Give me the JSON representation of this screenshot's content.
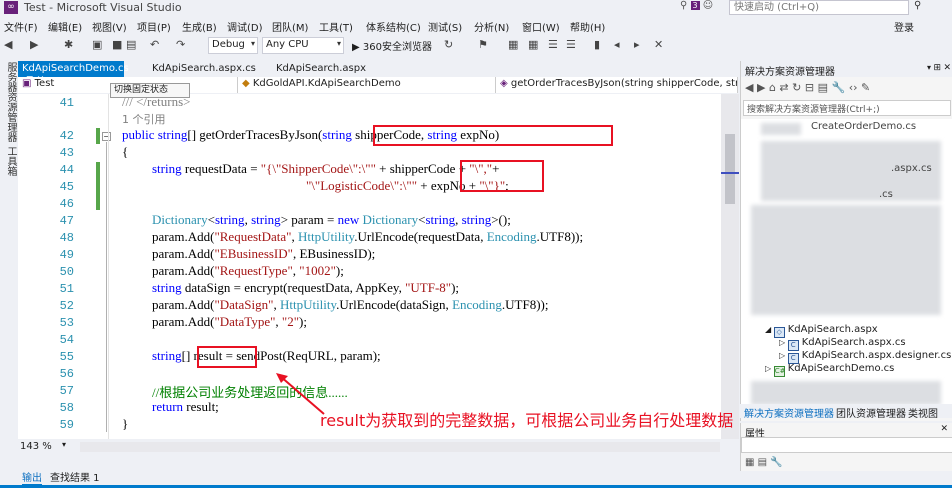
{
  "window": {
    "title": "Test - Microsoft Visual Studio",
    "notification_count": "3",
    "quick_launch_placeholder": "快速启动 (Ctrl+Q)",
    "login": "登录"
  },
  "menu": [
    "文件(F)",
    "编辑(E)",
    "视图(V)",
    "项目(P)",
    "生成(B)",
    "调试(D)",
    "团队(M)",
    "工具(T)",
    "体系结构(C)",
    "测试(S)",
    "分析(N)",
    "窗口(W)",
    "帮助(H)"
  ],
  "toolbar": {
    "config": "Debug",
    "platform": "Any CPU",
    "run_label": "▶ 360安全浏览器"
  },
  "left_strip": [
    "服务器资源管理器",
    "工具箱"
  ],
  "tabs": [
    {
      "label": "KdApiSearchDemo.cs",
      "active": true
    },
    {
      "label": "KdApiSearch.aspx.cs",
      "active": false
    },
    {
      "label": "KdApiSearch.aspx",
      "active": false
    }
  ],
  "tooltip": "切换固定状态",
  "navbar": {
    "project": "Test",
    "class": "KdGoldAPI.KdApiSearchDemo",
    "member": "getOrderTracesByJson(string shipperCode, string"
  },
  "code_lines": [
    {
      "n": "41",
      "text": "/// </returns>"
    },
    {
      "n": "",
      "text": "1 个引用"
    },
    {
      "n": "42",
      "text": "public string[] getOrderTracesByJson(string shipperCode, string expNo)"
    },
    {
      "n": "43",
      "text": "{"
    },
    {
      "n": "44",
      "text": "string requestData = \"{'ShipperCode':'\" + shipperCode + \"',\" +"
    },
    {
      "n": "45",
      "text": "\"'LogisticCode':'\" + expNo + \"'}\";"
    },
    {
      "n": "46",
      "text": ""
    },
    {
      "n": "47",
      "text": "Dictionary<string, string> param = new Dictionary<string, string>();"
    },
    {
      "n": "48",
      "text": "param.Add(\"RequestData\", HttpUtility.UrlEncode(requestData, Encoding.UTF8));"
    },
    {
      "n": "49",
      "text": "param.Add(\"EBusinessID\", EBusinessID);"
    },
    {
      "n": "50",
      "text": "param.Add(\"RequestType\", \"1002\");"
    },
    {
      "n": "51",
      "text": "string dataSign = encrypt(requestData, AppKey, \"UTF-8\");"
    },
    {
      "n": "52",
      "text": "param.Add(\"DataSign\", HttpUtility.UrlEncode(dataSign, Encoding.UTF8));"
    },
    {
      "n": "53",
      "text": "param.Add(\"DataType\", \"2\");"
    },
    {
      "n": "54",
      "text": ""
    },
    {
      "n": "55",
      "text": "string[] result = sendPost(ReqURL, param);"
    },
    {
      "n": "56",
      "text": ""
    },
    {
      "n": "57",
      "text": "//根据公司业务处理返回的信息......"
    },
    {
      "n": "58",
      "text": "return result;"
    },
    {
      "n": "59",
      "text": "}"
    }
  ],
  "zoom": "143 %",
  "output_tabs": [
    "输出",
    "查找结果 1"
  ],
  "solution_explorer": {
    "title": "解决方案资源管理器",
    "search_placeholder": "搜索解决方案资源管理器(Ctrl+;)",
    "partial_items": [
      "CreateOrderDemo.cs",
      ".aspx.cs",
      ".cs"
    ],
    "items": [
      "KdApiSearch.aspx",
      "KdApiSearch.aspx.cs",
      "KdApiSearch.aspx.designer.cs",
      "KdApiSearchDemo.cs"
    ],
    "bottom_tabs": [
      "解决方案资源管理器",
      "团队资源管理器",
      "类视图"
    ]
  },
  "properties": {
    "title": "属性"
  },
  "annotation": "result为获取到的完整数据，可根据公司业务自行处理数据",
  "colors": {
    "accent": "#007acc",
    "annotation_red": "#e81123",
    "keyword": "#0000ff",
    "type": "#2b91af",
    "string": "#a31515",
    "comment": "#008000"
  }
}
